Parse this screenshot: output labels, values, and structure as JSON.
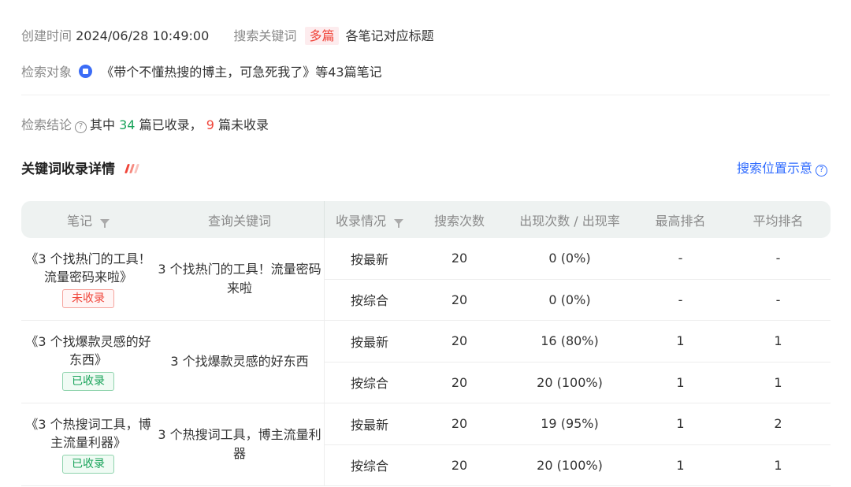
{
  "meta": {
    "created_label": "创建时间",
    "created_value": "2024/06/28 10:49:00",
    "keyword_label": "搜索关键词",
    "keyword_chip": "多篇",
    "keyword_value": "各笔记对应标题",
    "object_label": "检索对象",
    "object_value": "《带个不懂热搜的博主，可急死我了》等43篇笔记"
  },
  "conclusion": {
    "label": "检索结论",
    "prefix": "其中",
    "included_count": "34",
    "included_text": "篇已收录，",
    "excluded_count": "9",
    "excluded_text": "篇未收录"
  },
  "section": {
    "title": "关键词收录详情",
    "link": "搜索位置示意",
    "accent_colors": [
      "#f0453a",
      "#f58a80",
      "#f9c2bc"
    ]
  },
  "table": {
    "headers": [
      "笔记",
      "查询关键词",
      "收录情况",
      "搜索次数",
      "出现次数 / 出现率",
      "最高排名",
      "平均排名"
    ],
    "groups": [
      {
        "note": "《3 个找热门的工具！流量密码来啦》",
        "status": "未收录",
        "status_type": "excluded",
        "keyword": "3 个找热门的工具！流量密码来啦",
        "rows": [
          {
            "mode": "按最新",
            "searches": "20",
            "appear": "0 (0%)",
            "best": "-",
            "avg": "-"
          },
          {
            "mode": "按综合",
            "searches": "20",
            "appear": "0 (0%)",
            "best": "-",
            "avg": "-"
          }
        ]
      },
      {
        "note": "《3 个找爆款灵感的好东西》",
        "status": "已收录",
        "status_type": "included",
        "keyword": "3 个找爆款灵感的好东西",
        "rows": [
          {
            "mode": "按最新",
            "searches": "20",
            "appear": "16 (80%)",
            "best": "1",
            "avg": "1"
          },
          {
            "mode": "按综合",
            "searches": "20",
            "appear": "20 (100%)",
            "best": "1",
            "avg": "1"
          }
        ]
      },
      {
        "note": "《3 个热搜词工具，博主流量利器》",
        "status": "已收录",
        "status_type": "included",
        "keyword": "3 个热搜词工具，博主流量利器",
        "rows": [
          {
            "mode": "按最新",
            "searches": "20",
            "appear": "19 (95%)",
            "best": "1",
            "avg": "2"
          },
          {
            "mode": "按综合",
            "searches": "20",
            "appear": "20 (100%)",
            "best": "1",
            "avg": "1"
          }
        ]
      }
    ]
  }
}
